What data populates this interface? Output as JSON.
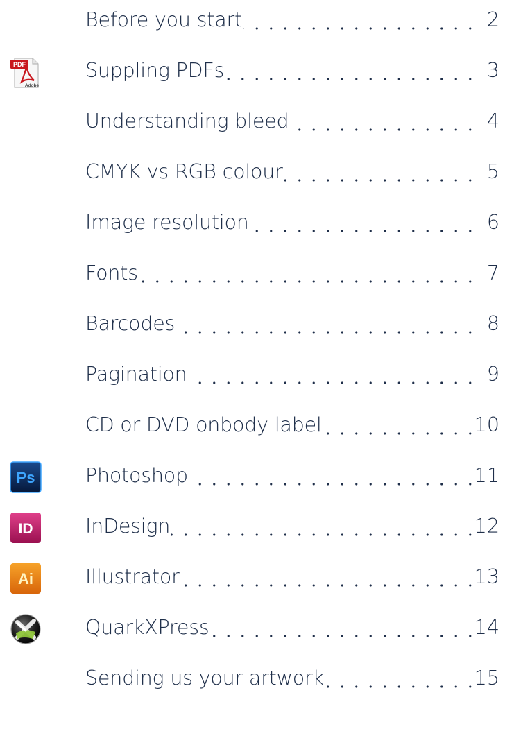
{
  "toc": {
    "entries": [
      {
        "label": "Before you start",
        "page": "2"
      },
      {
        "label": "Suppling PDFs",
        "page": "3",
        "icon": "pdf-icon"
      },
      {
        "label": "Understanding bleed",
        "page": "4"
      },
      {
        "label": "CMYK vs RGB colour",
        "page": "5"
      },
      {
        "label": "Image resolution",
        "page": "6"
      },
      {
        "label": "Fonts",
        "page": "7"
      },
      {
        "label": "Barcodes",
        "page": "8"
      },
      {
        "label": "Pagination",
        "page": "9"
      },
      {
        "label": "CD or DVD onbody label",
        "page": "10"
      },
      {
        "label": "Photoshop",
        "page": "11",
        "icon": "photoshop-icon"
      },
      {
        "label": "InDesign",
        "page": "12",
        "icon": "indesign-icon"
      },
      {
        "label": "Illustrator",
        "page": "13",
        "icon": "illustrator-icon"
      },
      {
        "label": "QuarkXPress",
        "page": "14",
        "icon": "quarkxpress-icon"
      },
      {
        "label": "Sending us your artwork",
        "page": "15"
      }
    ]
  },
  "icons": {
    "pdf": {
      "badge_text": "PDF",
      "caption": "Adobe",
      "badge_color": "#c8161d"
    },
    "photoshop": {
      "text": "Ps",
      "bg_color": "#0b2a5c",
      "fg_color": "#3ea6ff"
    },
    "indesign": {
      "text": "ID",
      "bg_color": "#c11b6b",
      "fg_color": "#ffffff"
    },
    "illustrator": {
      "text": "Ai",
      "bg_color": "#e87a10",
      "fg_color": "#fff3c0"
    }
  },
  "colors": {
    "text": "#1f2f4a",
    "background": "#ffffff"
  }
}
